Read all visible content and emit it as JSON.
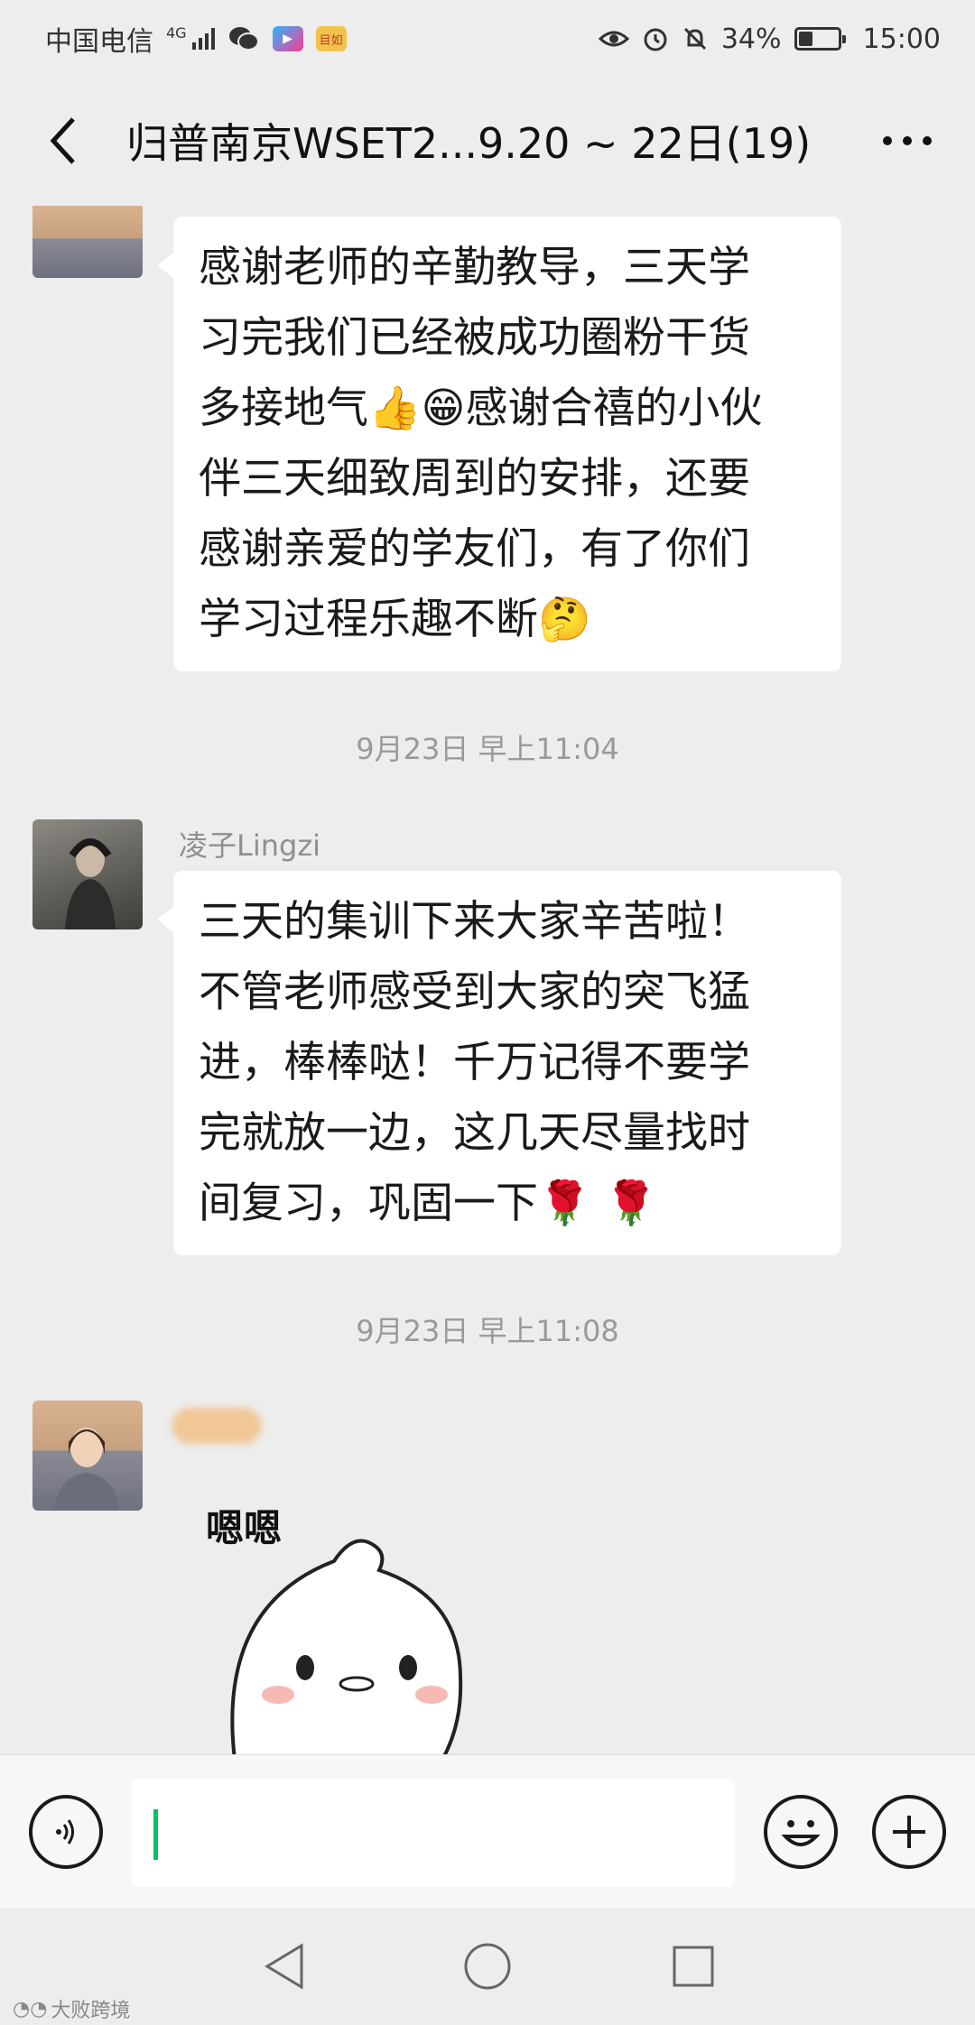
{
  "status_bar": {
    "carrier": "中国电信",
    "network": "4G",
    "app_badge": "目如",
    "battery": "34%",
    "battery_level": 0.34,
    "time": "15:00"
  },
  "header": {
    "title": "归普南京WSET2...9.20 ~ 22日(19)"
  },
  "messages": [
    {
      "text": "感谢老师的辛勤教导，三天学习完我们已经被成功圈粉干货多接地气👍😁感谢合禧的小伙伴三天细致周到的安排，还要感谢亲爱的学友们，有了你们学习过程乐趣不断🤔",
      "lines": [
        "感谢老师的辛勤教导，三天学",
        "习完我们已经被成功圈粉干货",
        "多接地气👍😁感谢合禧的小伙",
        "伴三天细致周到的安排，还要",
        "感谢亲爱的学友们，有了你们",
        "学习过程乐趣不断🤔"
      ]
    },
    {
      "timestamp": "9月23日 早上11:04",
      "sender": "凌子Lingzi",
      "lines": [
        "三天的集训下来大家辛苦啦！",
        "不管老师感受到大家的突飞猛",
        "进，棒棒哒！千万记得不要学",
        "完就放一边，这几天尽量找时",
        "间复习，巩固一下🌹 🌹"
      ]
    },
    {
      "timestamp": "9月23日 早上11:08",
      "sticker_text": "嗯嗯"
    }
  ],
  "watermark": "大败跨境",
  "colors": {
    "background": "#ededed",
    "bubble": "#ffffff",
    "caret": "#07c160"
  },
  "icons": {
    "back": "chevron-left-icon",
    "more": "more-dots-icon",
    "voice": "voice-icon",
    "emoji": "emoji-icon",
    "plus": "plus-icon"
  }
}
